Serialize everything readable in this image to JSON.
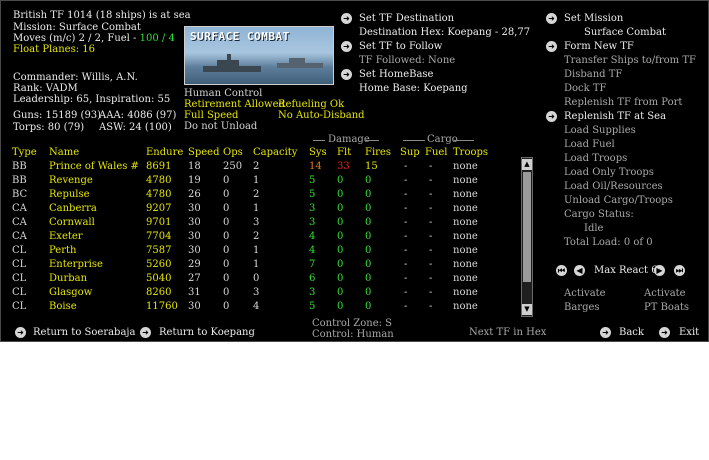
{
  "tf": {
    "heading": "British TF 1014 (18 ships) is at sea",
    "mission": "Mission:  Surface Combat",
    "moves_prefix": "Moves (m/c)  2 / 2, Fuel - ",
    "fuel": "100 / 4",
    "float_planes": "Float Planes: 16",
    "commander": "Commander: Willis, A.N.",
    "rank": "Rank: VADM",
    "leadership": "Leadership: 65, Inspiration: 55",
    "guns": "Guns: 15189 (93)",
    "torps": "Torps: 80 (79)",
    "aaa": "AAA: 4086 (97)",
    "asw": "ASW: 24 (100)"
  },
  "banner": {
    "title": "SURFACE COMBAT"
  },
  "control": {
    "human_control": "Human Control",
    "retirement": "Retirement Allowed",
    "refueling": "Refueling Ok",
    "speed": "Full Speed",
    "auto_disband": "No Auto-Disband",
    "unload": "Do not Unload"
  },
  "dest": {
    "set_dest": "Set TF Destination",
    "dest_hex": "Destination Hex: Koepang - 28,77",
    "set_follow": "Set TF to Follow",
    "followed": "TF Followed: None",
    "set_home": "Set HomeBase",
    "home": "Home Base: Koepang"
  },
  "group_headers": {
    "damage": "Damage",
    "cargo": "Cargo"
  },
  "columns": [
    "Type",
    "Name",
    "Endure",
    "Speed",
    "Ops",
    "Capacity",
    "Sys",
    "Flt",
    "Fires",
    "Sup",
    "Fuel",
    "Troops"
  ],
  "ships": [
    {
      "type": "BB",
      "name": "Prince of Wales #",
      "endure": "8691",
      "speed": "18",
      "ops": "250",
      "cap": "2",
      "sys": "14",
      "flt": "33",
      "fires": "15",
      "sup": "-",
      "fuel": "-",
      "troops": "none"
    },
    {
      "type": "BB",
      "name": "Revenge",
      "endure": "4780",
      "speed": "19",
      "ops": "0",
      "cap": "1",
      "sys": "5",
      "flt": "0",
      "fires": "0",
      "sup": "-",
      "fuel": "-",
      "troops": "none"
    },
    {
      "type": "BC",
      "name": "Repulse",
      "endure": "4780",
      "speed": "26",
      "ops": "0",
      "cap": "2",
      "sys": "5",
      "flt": "0",
      "fires": "0",
      "sup": "-",
      "fuel": "-",
      "troops": "none"
    },
    {
      "type": "CA",
      "name": "Canberra",
      "endure": "9207",
      "speed": "30",
      "ops": "0",
      "cap": "1",
      "sys": "3",
      "flt": "0",
      "fires": "0",
      "sup": "-",
      "fuel": "-",
      "troops": "none"
    },
    {
      "type": "CA",
      "name": "Cornwall",
      "endure": "9701",
      "speed": "30",
      "ops": "0",
      "cap": "3",
      "sys": "3",
      "flt": "0",
      "fires": "0",
      "sup": "-",
      "fuel": "-",
      "troops": "none"
    },
    {
      "type": "CA",
      "name": "Exeter",
      "endure": "7704",
      "speed": "30",
      "ops": "0",
      "cap": "2",
      "sys": "4",
      "flt": "0",
      "fires": "0",
      "sup": "-",
      "fuel": "-",
      "troops": "none"
    },
    {
      "type": "CL",
      "name": "Perth",
      "endure": "7587",
      "speed": "30",
      "ops": "0",
      "cap": "1",
      "sys": "4",
      "flt": "0",
      "fires": "0",
      "sup": "-",
      "fuel": "-",
      "troops": "none"
    },
    {
      "type": "CL",
      "name": "Enterprise",
      "endure": "5260",
      "speed": "29",
      "ops": "0",
      "cap": "1",
      "sys": "7",
      "flt": "0",
      "fires": "0",
      "sup": "-",
      "fuel": "-",
      "troops": "none"
    },
    {
      "type": "CL",
      "name": "Durban",
      "endure": "5040",
      "speed": "27",
      "ops": "0",
      "cap": "0",
      "sys": "6",
      "flt": "0",
      "fires": "0",
      "sup": "-",
      "fuel": "-",
      "troops": "none"
    },
    {
      "type": "CL",
      "name": "Glasgow",
      "endure": "8260",
      "speed": "31",
      "ops": "0",
      "cap": "3",
      "sys": "3",
      "flt": "0",
      "fires": "0",
      "sup": "-",
      "fuel": "-",
      "troops": "none"
    },
    {
      "type": "CL",
      "name": "Boise",
      "endure": "11760",
      "speed": "30",
      "ops": "0",
      "cap": "4",
      "sys": "5",
      "flt": "0",
      "fires": "0",
      "sup": "-",
      "fuel": "-",
      "troops": "none"
    }
  ],
  "right_menu": {
    "set_mission": "Set Mission",
    "mission_value": "Surface Combat",
    "form_new": "Form New TF",
    "transfer": "Transfer Ships to/from TF",
    "disband": "Disband TF",
    "dock": "Dock TF",
    "replenish_port": "Replenish TF from Port",
    "replenish_sea": "Replenish TF at Sea",
    "load_supplies": "Load Supplies",
    "load_fuel": "Load Fuel",
    "load_troops": "Load Troops",
    "load_only_troops": "Load Only Troops",
    "load_oil": "Load Oil/Resources",
    "unload": "Unload Cargo/Troops",
    "cargo_status": "Cargo Status:",
    "cargo_value": "Idle",
    "total_load": "Total Load: 0 of 0",
    "max_react": "Max React  6",
    "activate1": "Activate",
    "barges": "Barges",
    "activate2": "Activate",
    "pt_boats": "PT Boats"
  },
  "bottom": {
    "return1": "Return to Soerabaja",
    "return2": "Return to Koepang",
    "control_zone": "Control Zone: S",
    "control": "Control:     Human",
    "next_tf": "Next TF in Hex",
    "back": "Back",
    "exit": "Exit"
  },
  "colors": {
    "yellow": "#e6e600",
    "green": "#33e033",
    "red": "#e02020",
    "orange": "#e07a20"
  }
}
